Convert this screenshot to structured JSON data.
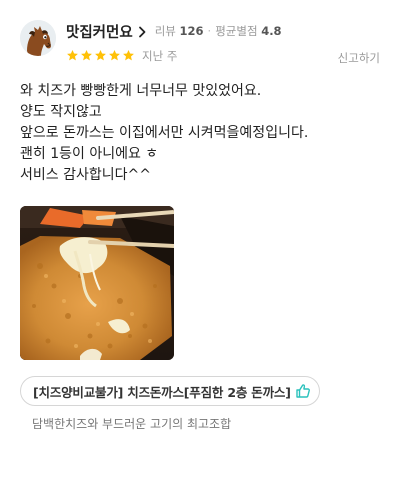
{
  "user": {
    "name": "맛집커먼요",
    "review_count_label": "리뷰",
    "review_count": "126",
    "avg_rating_label": "평균별점",
    "avg_rating": "4.8",
    "avatar_icon": "horse-avatar-icon"
  },
  "review": {
    "rating": 5,
    "rating_max": 5,
    "star_color": "#ffc107",
    "date": "지난 주",
    "report_label": "신고하기",
    "text_lines": [
      "와 치즈가 빵빵한게 너무너무 맛있었어요.",
      "양도 작지않고",
      "앞으로 돈까스는 이집에서만 시켜먹을예정입니다.",
      "괜히 1등이 아니에요 ㅎ",
      "서비스 감사합니다^^"
    ]
  },
  "menu": {
    "tag_label": "[치즈양비교불가] 치즈돈까스[푸짐한 2층 돈까스]",
    "like_icon": "thumbs-up-icon",
    "like_color": "#2ac1bc",
    "comment": "담백한치즈와 부드러운 고기의 최고조합"
  }
}
